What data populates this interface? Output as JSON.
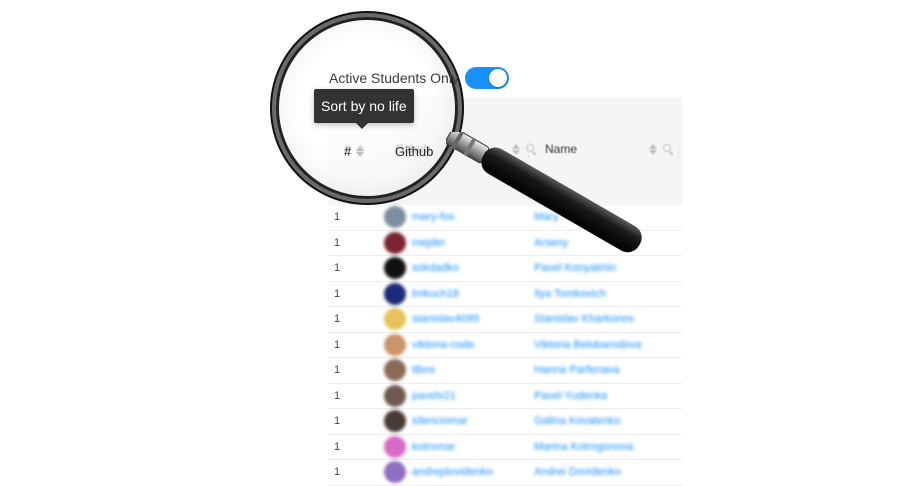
{
  "filter": {
    "label": "Active Students Only",
    "toggle_on": true
  },
  "tooltip": {
    "text": "Sort by no life"
  },
  "table": {
    "columns": {
      "index": "#",
      "github": "Github",
      "name": "Name"
    },
    "rows": [
      {
        "num": "1",
        "github": "mary-fox",
        "name": "Mary",
        "avatar_color": "#7b8f9f"
      },
      {
        "num": "1",
        "github": "mejder",
        "name": "Arseny",
        "avatar_color": "#7a2530"
      },
      {
        "num": "1",
        "github": "sokdadko",
        "name": "Pavel Konyakhin",
        "avatar_color": "#111111"
      },
      {
        "num": "1",
        "github": "lmkuch18",
        "name": "Ilya Tomkovich",
        "avatar_color": "#1b2a7a"
      },
      {
        "num": "1",
        "github": "stanislav4099",
        "name": "Stanislav Kharkonov",
        "avatar_color": "#e8c35a"
      },
      {
        "num": "1",
        "github": "viktoria-code",
        "name": "Viktoria Belobarodova",
        "avatar_color": "#c9946a"
      },
      {
        "num": "1",
        "github": "tibos",
        "name": "Hanna Parfenava",
        "avatar_color": "#8a6a55"
      },
      {
        "num": "1",
        "github": "pavelv21",
        "name": "Pavel Yudenka",
        "avatar_color": "#6e5a50"
      },
      {
        "num": "1",
        "github": "silenciomar",
        "name": "Galina Kovalenko",
        "avatar_color": "#4a3a35"
      },
      {
        "num": "1",
        "github": "kotromar",
        "name": "Marina Kotrogonova",
        "avatar_color": "#d96bc8"
      },
      {
        "num": "1",
        "github": "andrejdovidenko",
        "name": "Andrei Dovidenko",
        "avatar_color": "#8e6fc4"
      }
    ]
  }
}
